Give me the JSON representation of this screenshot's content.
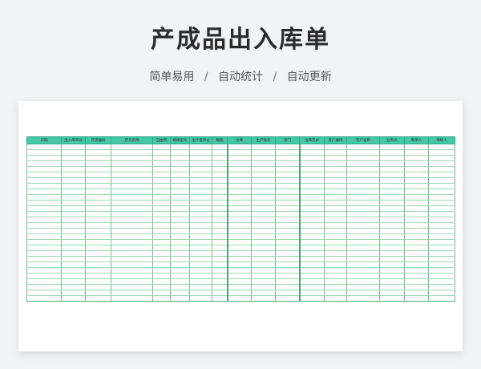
{
  "page": {
    "title": "产成品出入库单",
    "subtitle_parts": [
      "简单易用",
      "自动统计",
      "自动更新"
    ],
    "separator": "/"
  },
  "sheet": {
    "header_color": "#47c7a8",
    "columns": [
      "日期",
      "出入库单号",
      "存货编码",
      "存货名称",
      "自由项",
      "规格型号",
      "主计量单位",
      "数量",
      "仓库",
      "生产批号",
      "部门",
      "出库方式",
      "客户编码",
      "客户名称",
      "业务员",
      "制单人",
      "审核人"
    ],
    "empty_rows": 28
  }
}
